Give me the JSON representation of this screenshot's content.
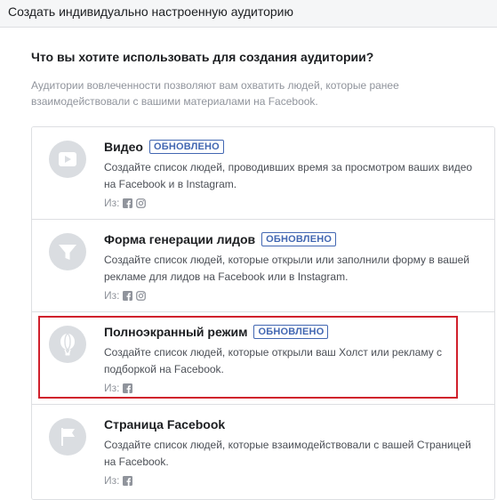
{
  "header": {
    "title": "Создать индивидуально настроенную аудиторию"
  },
  "section": {
    "question": "Что вы хотите использовать для создания аудитории?",
    "description": "Аудитории вовлеченности позволяют вам охватить людей, которые ранее взаимодействовали с вашими материалами на Facebook."
  },
  "options": [
    {
      "title": "Видео",
      "badge": "ОБНОВЛЕНО",
      "description": "Создайте список людей, проводивших время за просмотром ваших видео на Facebook и в Instagram.",
      "source_label": "Из:",
      "source_icons": [
        "facebook-icon",
        "instagram-icon"
      ],
      "icon": "video-icon"
    },
    {
      "title": "Форма генерации лидов",
      "badge": "ОБНОВЛЕНО",
      "description": "Создайте список людей, которые открыли или заполнили форму в вашей рекламе для лидов на Facebook или в Instagram.",
      "source_label": "Из:",
      "source_icons": [
        "facebook-icon",
        "instagram-icon"
      ],
      "icon": "funnel-icon"
    },
    {
      "title": "Полноэкранный режим",
      "badge": "ОБНОВЛЕНО",
      "description": "Создайте список людей, которые открыли ваш Холст или рекламу с подборкой на Facebook.",
      "source_label": "Из:",
      "source_icons": [
        "facebook-icon"
      ],
      "icon": "balloon-icon",
      "highlighted": true
    },
    {
      "title": "Страница Facebook",
      "badge": "",
      "description": "Создайте список людей, которые взаимодействовали с вашей Страницей на Facebook.",
      "source_label": "Из:",
      "source_icons": [
        "facebook-icon"
      ],
      "icon": "flag-icon"
    }
  ],
  "colors": {
    "accent": "#4267b2",
    "highlight_border": "#d0202c",
    "icon_circle": "#dadde1",
    "muted_text": "#90949c"
  }
}
